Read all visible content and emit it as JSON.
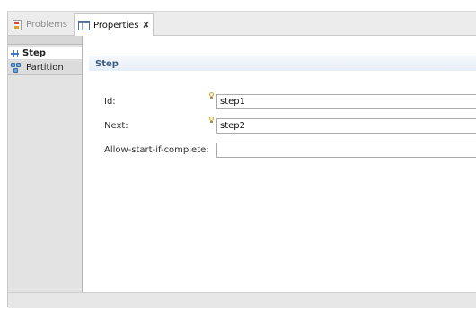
{
  "tabs": [
    {
      "label": "Problems",
      "icon": "problems-icon",
      "active": false
    },
    {
      "label": "Properties",
      "icon": "properties-icon",
      "active": true,
      "close_glyph": "✘"
    }
  ],
  "left_panel": {
    "items": [
      {
        "label": "Step",
        "icon": "step-icon",
        "selected": true
      },
      {
        "label": "Partition",
        "icon": "partition-icon",
        "selected": false
      }
    ]
  },
  "section": {
    "title": "Step"
  },
  "form": {
    "fields": [
      {
        "label": "Id:",
        "value": "step1"
      },
      {
        "label": "Next:",
        "value": "step2"
      },
      {
        "label": "Allow-start-if-complete:",
        "value": ""
      }
    ]
  },
  "colors": {
    "section_title": "#385d86",
    "accent": "#3f78c0"
  }
}
